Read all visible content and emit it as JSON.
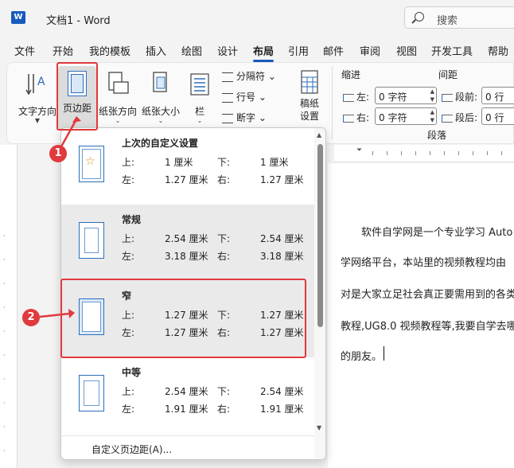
{
  "app": {
    "doc_name": "文档1",
    "separator": "-",
    "app_name": "Word",
    "title": "文档1  -  Word"
  },
  "search": {
    "label": "搜索",
    "icon": "search-icon"
  },
  "menu": [
    "文件",
    "开始",
    "我的模板",
    "插入",
    "绘图",
    "设计",
    "布局",
    "引用",
    "邮件",
    "审阅",
    "视图",
    "开发工具",
    "帮助"
  ],
  "menu_active": "布局",
  "ribbon": {
    "text_direction": "文字方向",
    "margins": "页边距",
    "orientation": "纸张方向",
    "size": "纸张大小",
    "columns": "栏",
    "breaks": "分隔符",
    "line_numbers": "行号",
    "hyphenation": "断字",
    "manuscript": [
      "稿纸",
      "设置"
    ],
    "indent_label": "缩进",
    "spacing_label": "间距",
    "left": "左:",
    "right": "右:",
    "before": "段前:",
    "after": "段后:",
    "left_value": "0 字符",
    "right_value": "0 字符",
    "before_value": "0 行",
    "after_value": "0 行",
    "paragraph_group": "段落"
  },
  "margins_menu": {
    "options": [
      {
        "title": "上次的自定义设置",
        "top_label": "上:",
        "top": "1 厘米",
        "bottom_label": "下:",
        "bottom": "1 厘米",
        "left_label": "左:",
        "left": "1.27 厘米",
        "right_label": "右:",
        "right": "1.27 厘米"
      },
      {
        "title": "常规",
        "top_label": "上:",
        "top": "2.54 厘米",
        "bottom_label": "下:",
        "bottom": "2.54 厘米",
        "left_label": "左:",
        "left": "3.18 厘米",
        "right_label": "右:",
        "right": "3.18 厘米"
      },
      {
        "title": "窄",
        "top_label": "上:",
        "top": "1.27 厘米",
        "bottom_label": "下:",
        "bottom": "1.27 厘米",
        "left_label": "左:",
        "left": "1.27 厘米",
        "right_label": "右:",
        "right": "1.27 厘米"
      },
      {
        "title": "中等",
        "top_label": "上:",
        "top": "2.54 厘米",
        "bottom_label": "下:",
        "bottom": "2.54 厘米",
        "left_label": "左:",
        "left": "1.91 厘米",
        "right_label": "右:",
        "right": "1.91 厘米"
      }
    ],
    "custom": "自定义页边距(A)..."
  },
  "document": {
    "lines": [
      "软件自学网是一个专业学习  Auto",
      "学网络平台，本站里的视频教程均由",
      "对是大家立足社会真正要需用到的各类",
      "教程,UG8.0 视频教程等,我要自学去哪",
      "的朋友。"
    ]
  },
  "annotations": {
    "badge1": "1",
    "badge2": "2"
  },
  "colors": {
    "accent": "#185abd",
    "highlight": "#e0393e",
    "icon_blue": "#2a6ebb"
  }
}
